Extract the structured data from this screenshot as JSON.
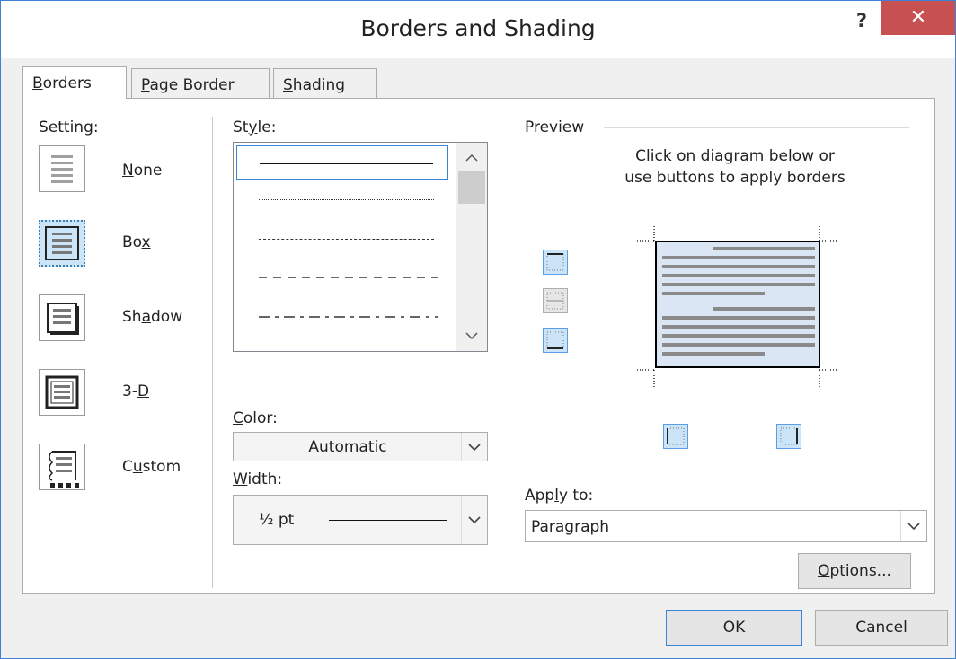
{
  "dialog": {
    "title": "Borders and Shading",
    "help_label": "?",
    "close_label": "✕"
  },
  "tabs": [
    {
      "label": "Borders",
      "active": true
    },
    {
      "label": "Page Border",
      "active": false
    },
    {
      "label": "Shading",
      "active": false
    }
  ],
  "setting": {
    "heading": "Setting:",
    "items": [
      {
        "label": "None",
        "icon": "none-setting-icon"
      },
      {
        "label": "Box",
        "icon": "box-setting-icon",
        "selected": true
      },
      {
        "label": "Shadow",
        "icon": "shadow-setting-icon"
      },
      {
        "label": "3-D",
        "icon": "3d-setting-icon"
      },
      {
        "label": "Custom",
        "icon": "custom-setting-icon"
      }
    ]
  },
  "style": {
    "heading": "Style:",
    "items": [
      "solid",
      "dotted",
      "dashed-fine",
      "dashed",
      "dash-dot"
    ],
    "selected": "solid"
  },
  "color": {
    "heading": "Color:",
    "value": "Automatic"
  },
  "width": {
    "heading": "Width:",
    "value": "½ pt"
  },
  "preview": {
    "heading": "Preview",
    "instruction_line1": "Click on diagram below or",
    "instruction_line2": "use buttons to apply borders"
  },
  "apply_to": {
    "heading": "Apply to:",
    "value": "Paragraph"
  },
  "buttons": {
    "options": "Options...",
    "ok": "OK",
    "cancel": "Cancel"
  },
  "colors": {
    "accent": "#3c82d6",
    "close_red": "#c75050",
    "selected_fill": "#cce4f7",
    "preview_fill": "#dbe6f4"
  }
}
